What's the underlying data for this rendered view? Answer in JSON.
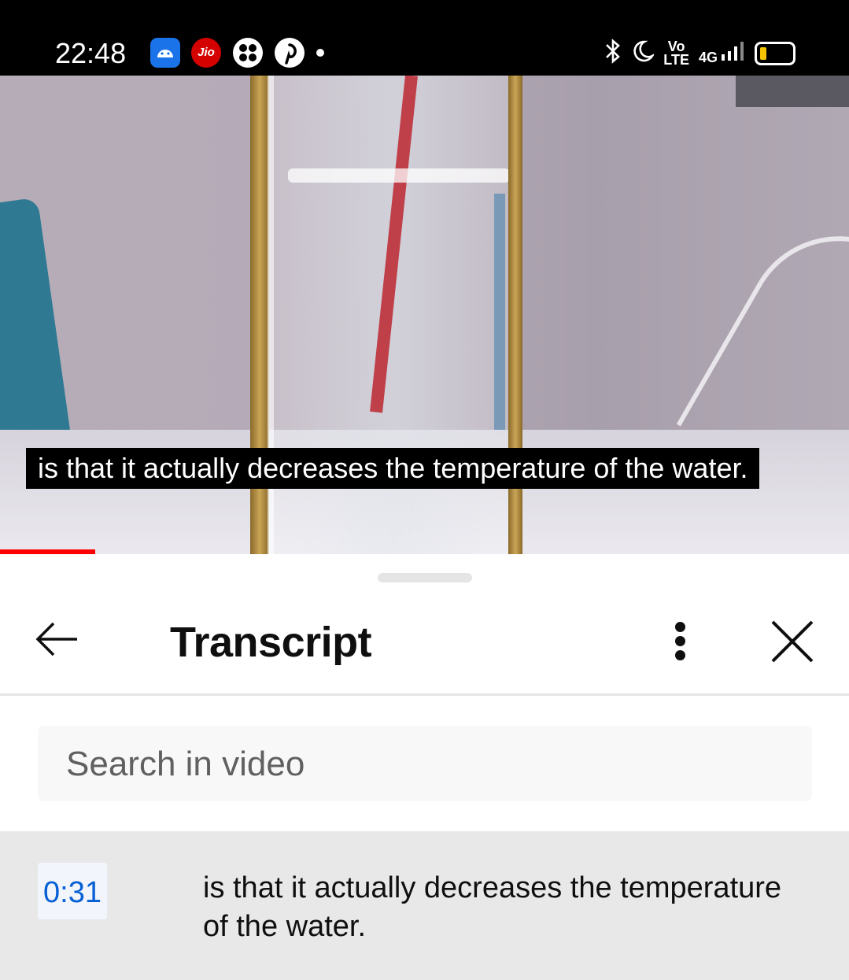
{
  "status_bar": {
    "time": "22:48",
    "icons": [
      "android-icon",
      "jio-icon",
      "fan-icon",
      "pinterest-icon",
      "dot-icon",
      "bluetooth-icon",
      "do-not-disturb-icon",
      "volte-icon",
      "signal-icon",
      "battery-icon"
    ],
    "jio_label": "Jio",
    "volte_label": "Vo\nLTE",
    "network_label": "4G"
  },
  "video": {
    "caption": "is that it actually decreases the temperature of the water.",
    "progress_fraction": 0.112,
    "progress_color": "#ff0000"
  },
  "transcript_panel": {
    "title": "Transcript",
    "search_placeholder": "Search in video",
    "segments": [
      {
        "timestamp": "0:31",
        "text": "is that it actually decreases the temperature of the water."
      }
    ],
    "accent_color": "#065fd4"
  }
}
